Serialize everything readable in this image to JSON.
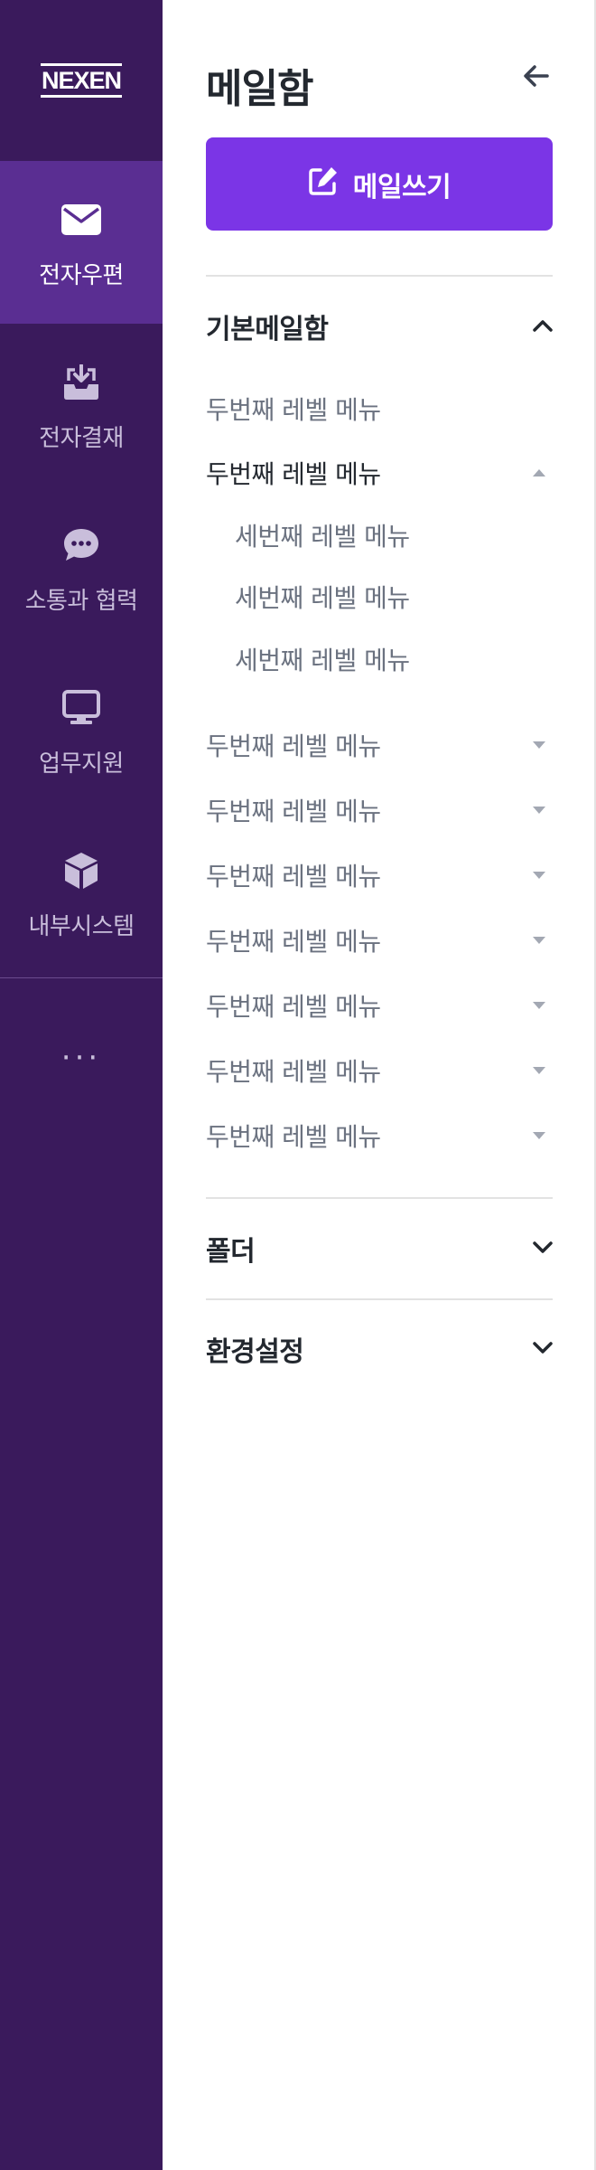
{
  "rail": {
    "logo": "NEXEN",
    "items": [
      {
        "label": "전자우편",
        "icon": "envelope-icon"
      },
      {
        "label": "전자결재",
        "icon": "inbox-download-icon"
      },
      {
        "label": "소통과 협력",
        "icon": "chat-bubble-icon"
      },
      {
        "label": "업무지원",
        "icon": "monitor-icon"
      },
      {
        "label": "내부시스템",
        "icon": "cube-icon"
      }
    ],
    "more": "···"
  },
  "panel": {
    "title": "메일함",
    "compose_label": "메일쓰기",
    "sections": [
      {
        "title": "기본메일함",
        "expanded": true,
        "items": [
          {
            "label": "두번째 레벨 메뉴",
            "state": "none"
          },
          {
            "label": "두번째 레벨 메뉴",
            "state": "open",
            "children": [
              {
                "label": "세번째 레벨 메뉴"
              },
              {
                "label": "세번째 레벨 메뉴"
              },
              {
                "label": "세번째 레벨 메뉴"
              }
            ]
          },
          {
            "label": "두번째 레벨 메뉴",
            "state": "closed"
          },
          {
            "label": "두번째 레벨 메뉴",
            "state": "closed"
          },
          {
            "label": "두번째 레벨 메뉴",
            "state": "closed"
          },
          {
            "label": "두번째 레벨 메뉴",
            "state": "closed"
          },
          {
            "label": "두번째 레벨 메뉴",
            "state": "closed"
          },
          {
            "label": "두번째 레벨 메뉴",
            "state": "closed"
          },
          {
            "label": "두번째 레벨 메뉴",
            "state": "closed"
          }
        ]
      },
      {
        "title": "폴더",
        "expanded": false
      },
      {
        "title": "환경설정",
        "expanded": false
      }
    ]
  },
  "colors": {
    "rail_bg": "#3a1a5c",
    "rail_active_bg": "#5a2e92",
    "accent": "#7b35e6"
  }
}
